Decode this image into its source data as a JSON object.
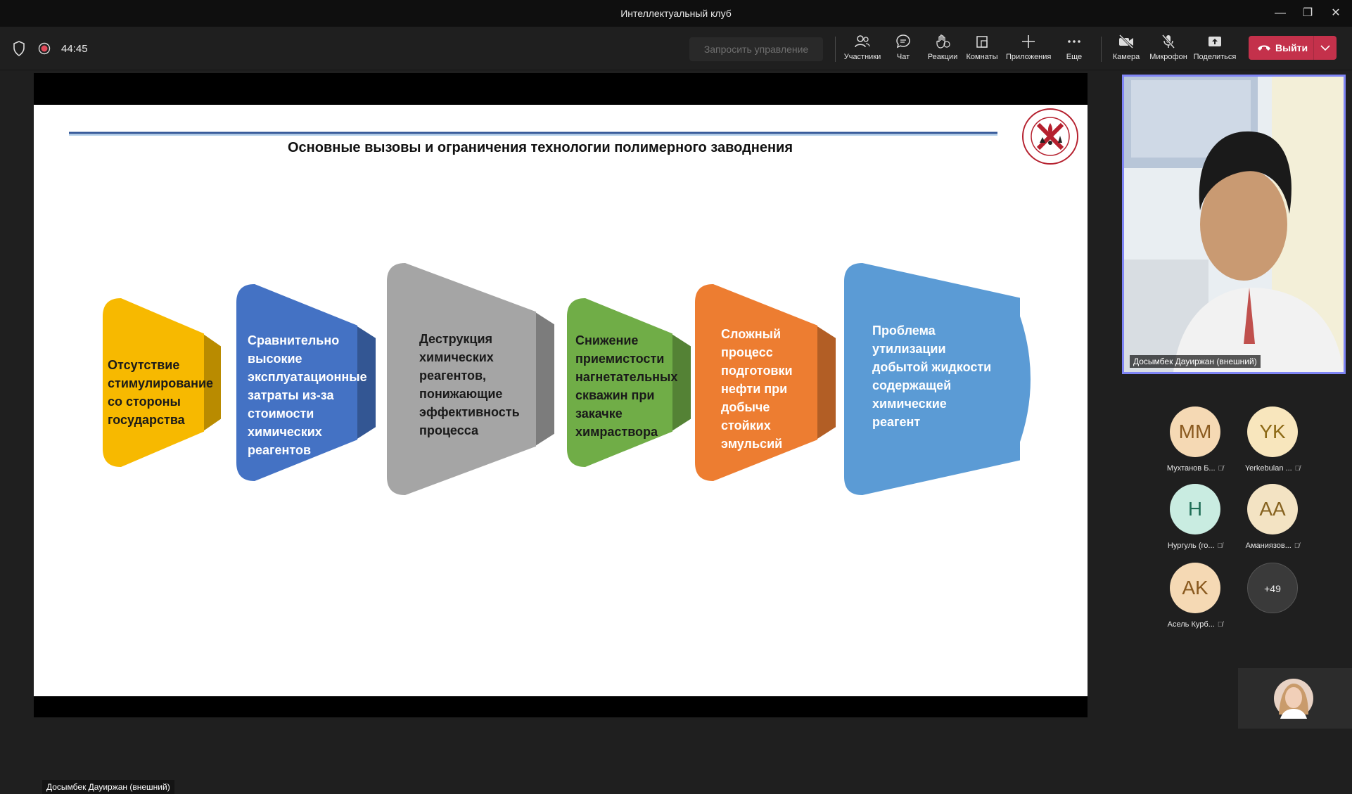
{
  "window": {
    "title": "Интеллектуальный клуб"
  },
  "meeting": {
    "elapsed": "44:45",
    "request_control_label": "Запросить управление"
  },
  "toolbar": {
    "participants": "Участники",
    "chat": "Чат",
    "reactions": "Реакции",
    "rooms": "Комнаты",
    "apps": "Приложения",
    "more": "Еще",
    "camera": "Камера",
    "mic": "Микрофон",
    "share": "Поделиться",
    "leave": "Выйти"
  },
  "slide": {
    "title": "Основные вызовы и ограничения технологии полимерного заводнения",
    "items": [
      {
        "text": "Отсутствие стимулирование со стороны государства",
        "color": "#f7b900"
      },
      {
        "text": "Сравнительно высокие эксплуатационные затраты из-за стоимости химических реагентов",
        "color": "#4472c4"
      },
      {
        "text": "Деструкция химических реагентов, понижающие эффективность процесса",
        "color": "#a5a5a5"
      },
      {
        "text": "Снижение приемистости нагнетательных скважин при закачке химраствора",
        "color": "#70ad47"
      },
      {
        "text": "Сложный процесс подготовки нефти при добыче стойких эмульсий",
        "color": "#ed7d31"
      },
      {
        "text": "Проблема утилизации добытой жидкости содержащей химические реагент",
        "color": "#5b9bd5"
      }
    ]
  },
  "presenter": {
    "name": "Досымбек Дауиржан (внешний)"
  },
  "participants": [
    {
      "initials": "MM",
      "name": "Мухтанов Б...",
      "bg": "#f5d9b4",
      "fg": "#8a5a1f"
    },
    {
      "initials": "YK",
      "name": "Yerkebulan ...",
      "bg": "#f8e6bd",
      "fg": "#8d6a16"
    },
    {
      "initials": "H",
      "name": "Нургуль (го...",
      "bg": "#c9ece1",
      "fg": "#1f6e56"
    },
    {
      "initials": "AA",
      "name": "Аманиязов...",
      "bg": "#f3e3c3",
      "fg": "#86621f"
    },
    {
      "initials": "AK",
      "name": "Асель Курб...",
      "bg": "#f5d9b4",
      "fg": "#8a5a1f"
    }
  ],
  "overflow_count": "+49"
}
